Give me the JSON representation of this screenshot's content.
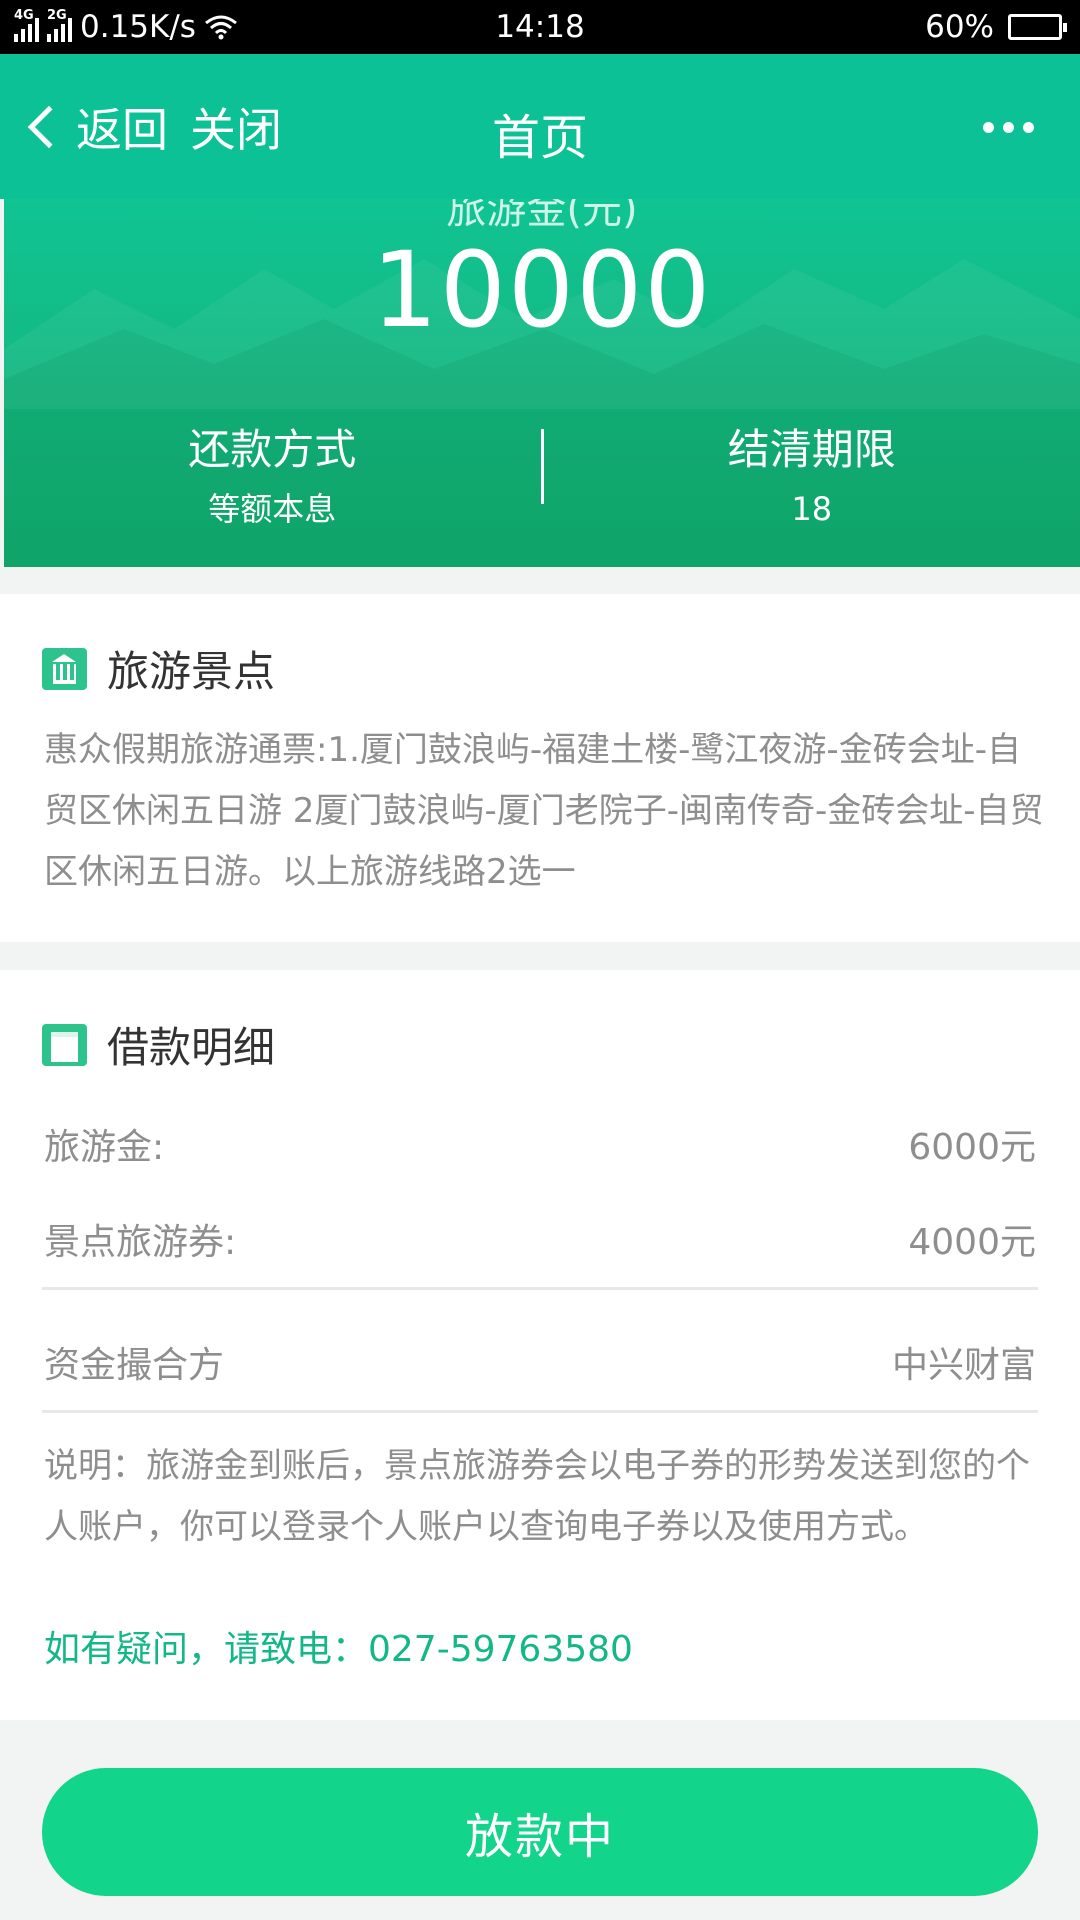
{
  "status_bar": {
    "net1": "4G",
    "net2": "2G",
    "speed": "0.15K/s",
    "time": "14:18",
    "battery": "60%",
    "battery_level": 0.6
  },
  "nav": {
    "back_label": "返回",
    "close_label": "关闭",
    "title": "首页"
  },
  "hero": {
    "label": "旅游金(元)",
    "amount": "10000",
    "repay_key": "还款方式",
    "repay_value": "等额本息",
    "term_key": "结清期限",
    "term_value": "18"
  },
  "scenic": {
    "title": "旅游景点",
    "description": "惠众假期旅游通票:1.厦门鼓浪屿-福建土楼-鹭江夜游-金砖会址-自贸区休闲五日游 2厦门鼓浪屿-厦门老院子-闽南传奇-金砖会址-自贸区休闲五日游。以上旅游线路2选一"
  },
  "loan": {
    "title": "借款明细",
    "rows": [
      {
        "label": "旅游金:",
        "value": "6000元"
      },
      {
        "label": "景点旅游券:",
        "value": "4000元"
      }
    ],
    "matcher_label": "资金撮合方",
    "matcher_value": "中兴财富",
    "note": "说明：旅游金到账后，景点旅游券会以电子券的形势发送到您的个人账户，你可以登录个人账户以查询电子券以及使用方式。",
    "hotline": "如有疑问，请致电：027-59763580"
  },
  "cta": {
    "label": "放款中"
  },
  "colors": {
    "brand": "#0dc196",
    "button": "#12d48a",
    "hotline": "#14b787"
  },
  "icons": [
    "signal-icon",
    "wifi-icon",
    "battery-icon",
    "back-icon",
    "more-icon",
    "temple-icon",
    "document-icon"
  ]
}
